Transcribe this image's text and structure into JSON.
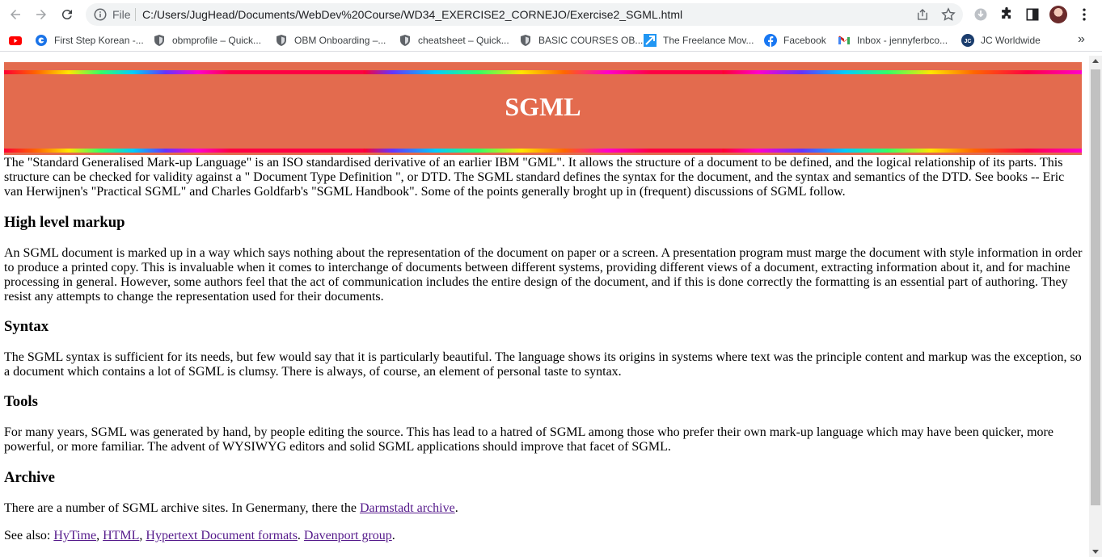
{
  "browser": {
    "file_label": "File",
    "url": "C:/Users/JugHead/Documents/WebDev%20Course/WD34_EXERCISE2_CORNEJO/Exercise2_SGML.html",
    "bookmarks": [
      {
        "label": "",
        "icon": "youtube-icon"
      },
      {
        "label": "First Step Korean -...",
        "icon": "google-icon"
      },
      {
        "label": "obmprofile – Quick...",
        "icon": "shield-icon"
      },
      {
        "label": "OBM Onboarding –...",
        "icon": "shield-icon"
      },
      {
        "label": "cheatsheet – Quick...",
        "icon": "shield-icon"
      },
      {
        "label": "BASIC COURSES OB...",
        "icon": "shield-icon"
      },
      {
        "label": "The Freelance Mov...",
        "icon": "freelance-icon"
      },
      {
        "label": "Facebook",
        "icon": "facebook-icon"
      },
      {
        "label": "Inbox - jennyferbco...",
        "icon": "gmail-icon"
      },
      {
        "label": "JC Worldwide",
        "icon": "jc-icon"
      }
    ],
    "bookmarks_more": "»"
  },
  "page": {
    "title": "SGML",
    "intro": "The \"Standard Generalised Mark-up Language\" is an ISO standardised derivative of an earlier IBM \"GML\". It allows the structure of a document to be defined, and the logical relationship of its parts. This structure can be checked for validity against a \" Document Type Definition \", or DTD. The SGML standard defines the syntax for the document, and the syntax and semantics of the DTD. See books -- Eric van Herwijnen's \"Practical SGML\" and Charles Goldfarb's \"SGML Handbook\". Some of the points generally broght up in (frequent) discussions of SGML follow.",
    "sections": [
      {
        "heading": "High level markup",
        "text": "An SGML document is marked up in a way which says nothing about the representation of the document on paper or a screen. A presentation program must marge the document with style information in order to produce a printed copy. This is invaluable when it comes to interchange of documents between different systems, providing different views of a document, extracting information about it, and for machine processing in general. However, some authors feel that the act of communication includes the entire design of the document, and if this is done correctly the formatting is an essential part of authoring. They resist any attempts to change the representation used for their documents."
      },
      {
        "heading": "Syntax",
        "text": "The SGML syntax is sufficient for its needs, but few would say that it is particularly beautiful. The language shows its origins in systems where text was the principle content and markup was the exception, so a document which contains a lot of SGML is clumsy. There is always, of course, an element of personal taste to syntax."
      },
      {
        "heading": "Tools",
        "text": "For many years, SGML was generated by hand, by people editing the source. This has lead to a hatred of SGML among those who prefer their own mark-up language which may have been quicker, more powerful, or more familiar. The advent of WYSIWYG editors and solid SGML applications should improve that facet of SGML."
      },
      {
        "heading": "Archive",
        "text_before": "There are a number of SGML archive sites. In Genermany, there the ",
        "link": "Darmstadt archive",
        "text_after": "."
      }
    ],
    "see_also": {
      "prefix": "See also: ",
      "links": [
        "HyTime",
        "HTML",
        "Hypertext Document formats",
        "Davenport group"
      ],
      "sep1": ", ",
      "sep2": ", ",
      "sep3": ". ",
      "suffix": "."
    }
  },
  "colors": {
    "header_bg": "#e36b4e",
    "title_text": "#ffffff",
    "link_visited": "#551a8b"
  }
}
